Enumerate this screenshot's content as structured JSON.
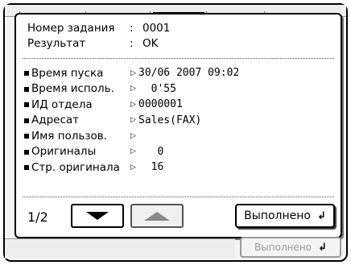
{
  "header": {
    "job_number_label": "Номер задания",
    "job_number_value": "0001",
    "result_label": "Результат",
    "result_value": "OK",
    "colon": ":"
  },
  "details": [
    {
      "label": "Время пуска",
      "value": "30/06 2007 09:02"
    },
    {
      "label": "Время исполь.",
      "value": "  0'55"
    },
    {
      "label": "ИД отдела",
      "value": "0000001"
    },
    {
      "label": "Адресат",
      "value": "Sales(FAX)"
    },
    {
      "label": "Имя пользов.",
      "value": ""
    },
    {
      "label": "Оригиналы",
      "value": "   0"
    },
    {
      "label": "Стр. оригинала",
      "value": "  16"
    }
  ],
  "pager": {
    "page": "1/2"
  },
  "buttons": {
    "done_label": "Выполнено",
    "bottom_done_label": "Выполнено"
  },
  "icons": {
    "arrow_down": "triangle-down-icon",
    "arrow_up": "triangle-up-icon",
    "enter": "enter-icon"
  }
}
